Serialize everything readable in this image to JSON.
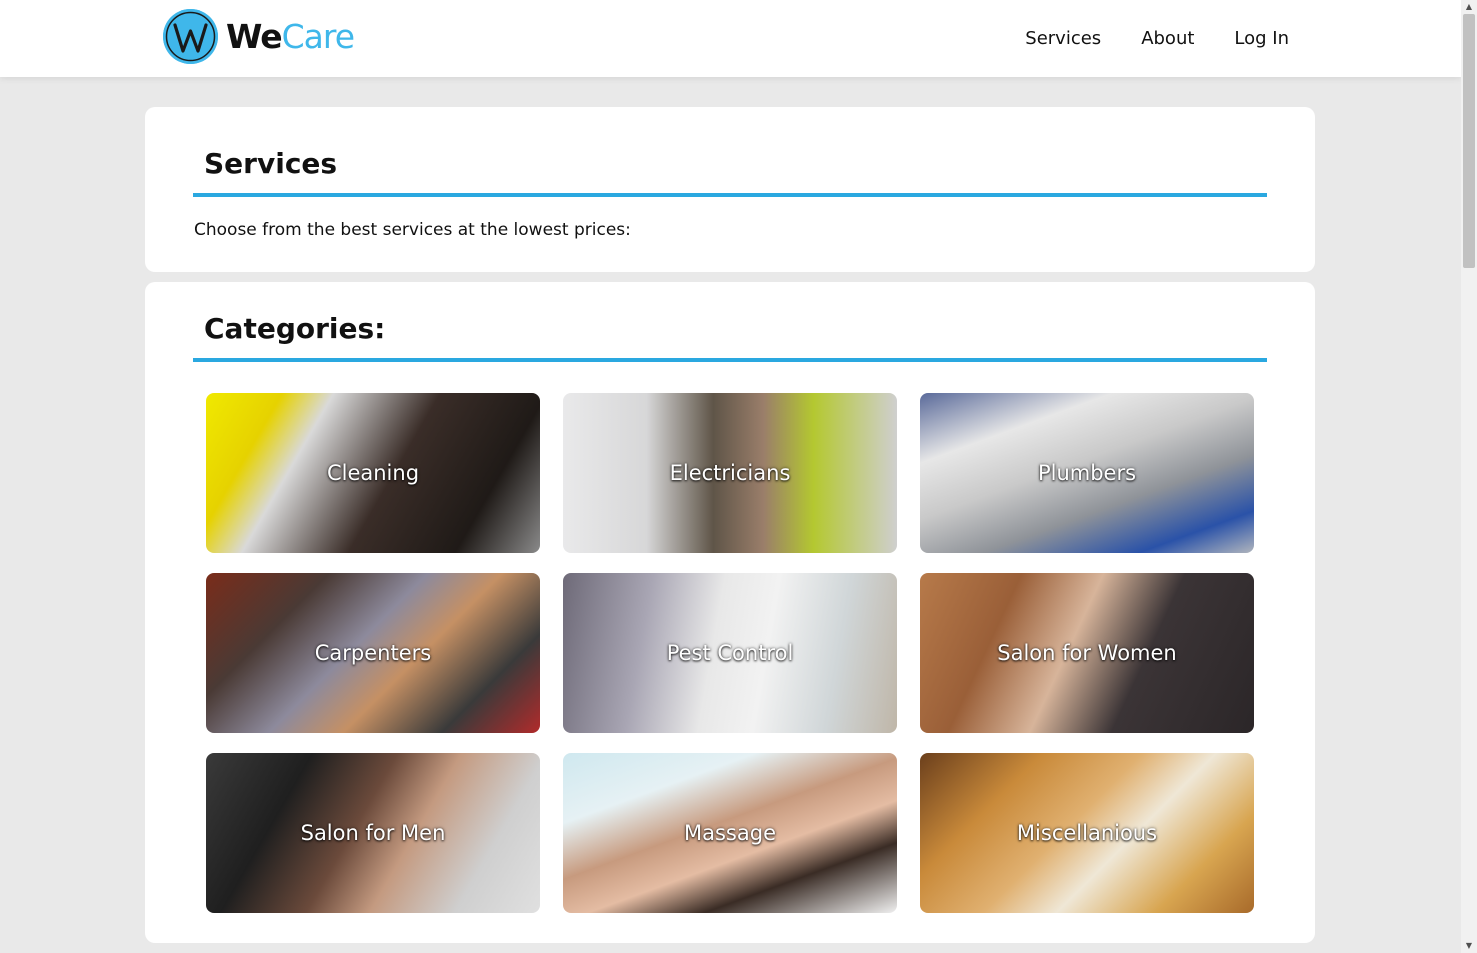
{
  "brand": {
    "logo_letter": "W",
    "name_part1": "We",
    "name_part2": "Care",
    "accent_color": "#3fb7ea"
  },
  "nav": {
    "items": [
      {
        "label": "Services"
      },
      {
        "label": "About"
      },
      {
        "label": "Log In"
      }
    ]
  },
  "services_card": {
    "heading": "Services",
    "intro": "Choose from the best services at the lowest prices:"
  },
  "categories_card": {
    "heading": "Categories:",
    "tiles": [
      {
        "label": "Cleaning",
        "icon": "cleaning-photo"
      },
      {
        "label": "Electricians",
        "icon": "electrician-photo"
      },
      {
        "label": "Plumbers",
        "icon": "plumber-photo"
      },
      {
        "label": "Carpenters",
        "icon": "carpenter-photo"
      },
      {
        "label": "Pest Control",
        "icon": "pest-control-photo"
      },
      {
        "label": "Salon for Women",
        "icon": "salon-women-photo"
      },
      {
        "label": "Salon for Men",
        "icon": "salon-men-photo"
      },
      {
        "label": "Massage",
        "icon": "massage-photo"
      },
      {
        "label": "Miscellanious",
        "icon": "miscellaneous-photo"
      }
    ]
  }
}
